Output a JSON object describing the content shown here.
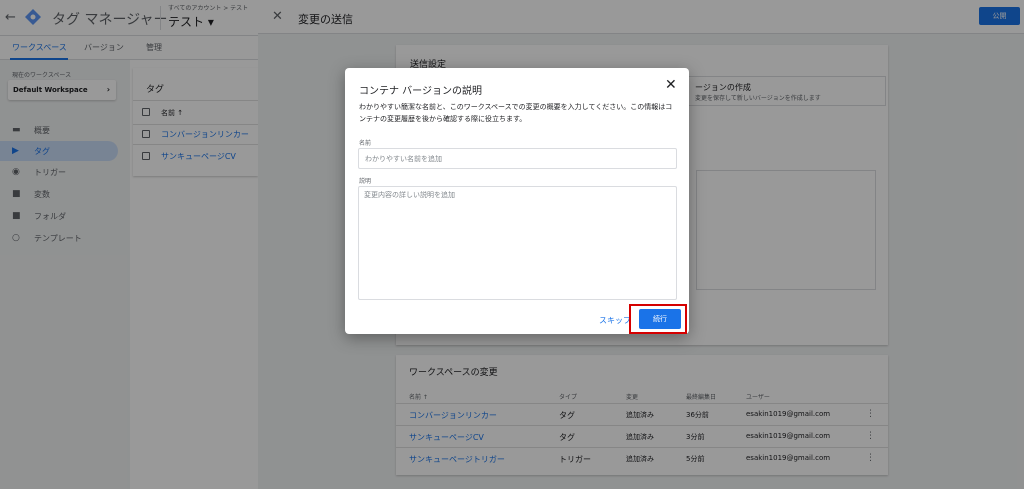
{
  "app": {
    "title": "タグ マネージャー",
    "breadcrumb": "すべてのアカウント > テスト",
    "container": "テスト ▾",
    "tabs": [
      "ワークスペース",
      "バージョン",
      "管理"
    ],
    "workspace_label": "現在のワークスペース",
    "workspace_name": "Default Workspace",
    "nav": [
      "概要",
      "タグ",
      "トリガー",
      "変数",
      "フォルダ",
      "テンプレート"
    ],
    "tags_title": "タグ",
    "tags_column": "名前 ↑",
    "tags": [
      "コンバージョンリンカー",
      "サンキューページCV"
    ]
  },
  "panel": {
    "title": "変更の送信",
    "publish": "公開",
    "settings_title": "送信設定",
    "version_box_title": "ージョンの作成",
    "version_box_sub": "変更を保存して新しいバージョンを作成します",
    "changes_title": "ワークスペースの変更",
    "columns": [
      "名前 ↑",
      "タイプ",
      "変更",
      "最終編集日",
      "ユーザー"
    ],
    "rows": [
      {
        "name": "コンバージョンリンカー",
        "type": "タグ",
        "change": "追加済み",
        "edited": "36分前",
        "user": "esakin1019@gmail.com"
      },
      {
        "name": "サンキューページCV",
        "type": "タグ",
        "change": "追加済み",
        "edited": "3分前",
        "user": "esakin1019@gmail.com"
      },
      {
        "name": "サンキューページトリガー",
        "type": "トリガー",
        "change": "追加済み",
        "edited": "5分前",
        "user": "esakin1019@gmail.com"
      }
    ]
  },
  "dialog": {
    "title": "コンテナ バージョンの説明",
    "description": "わかりやすい簡潔な名前と、このワークスペースでの変更の概要を入力してください。この情報はコンテナの変更履歴を後から確認する際に役立ちます。",
    "name_label": "名前",
    "name_placeholder": "わかりやすい名前を追加",
    "desc_label": "説明",
    "desc_placeholder": "変更内容の詳しい説明を追加",
    "skip": "スキップ",
    "continue": "続行"
  },
  "colors": {
    "accent": "#1a73e8",
    "highlight": "#d50000"
  }
}
